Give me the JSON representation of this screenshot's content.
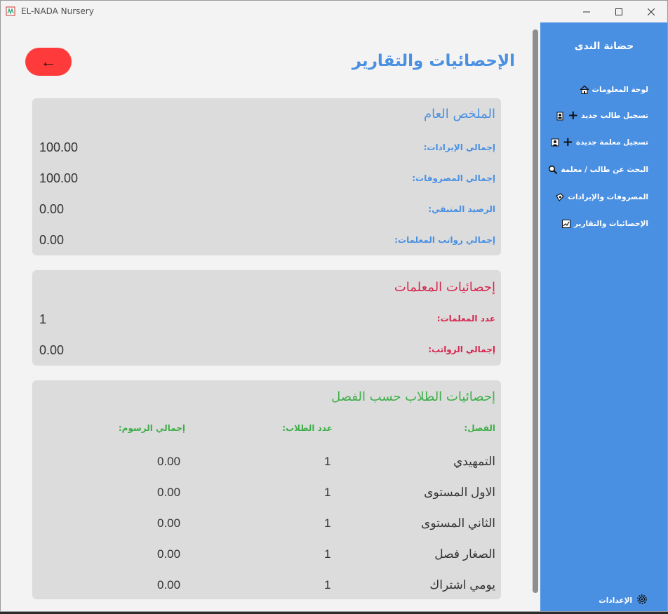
{
  "window": {
    "title": "EL-NADA Nursery"
  },
  "sidebar": {
    "title": "حضانة الندى",
    "items": [
      {
        "label": "لوحة المعلومات",
        "icon": "house-icon"
      },
      {
        "label": "تسجيل طالب جديد",
        "icon": "add-student-icon"
      },
      {
        "label": "تسجيل معلمة جديدة",
        "icon": "add-teacher-icon"
      },
      {
        "label": "البحث عن طالب / معلمة",
        "icon": "search-icon"
      },
      {
        "label": "المصروفات والإيرادات",
        "icon": "money-icon"
      },
      {
        "label": "الإحصائيات والتقارير",
        "icon": "chart-icon"
      }
    ],
    "settings_label": "الإعدادات"
  },
  "main": {
    "back_label": "←",
    "title": "الإحصائيات والتقارير",
    "summary": {
      "title": "الملخص العام",
      "rows": [
        {
          "label": "إجمالي الإيرادات:",
          "value": "100.00"
        },
        {
          "label": "إجمالي المصروفات:",
          "value": "100.00"
        },
        {
          "label": "الرصيد المتبقي:",
          "value": "0.00"
        },
        {
          "label": "إجمالي رواتب المعلمات:",
          "value": "0.00"
        }
      ]
    },
    "teachers": {
      "title": "إحصائيات المعلمات",
      "rows": [
        {
          "label": "عدد المعلمات:",
          "value": "1"
        },
        {
          "label": "إجمالي الرواتب:",
          "value": "0.00"
        }
      ]
    },
    "students": {
      "title": "إحصائيات الطلاب حسب الفصل",
      "columns": [
        "الفصل:",
        "عدد الطلاب:",
        "إجمالي الرسوم:"
      ],
      "rows": [
        {
          "class": "التمهيدي",
          "count": "1",
          "fees": "0.00"
        },
        {
          "class": "الاول المستوى",
          "count": "1",
          "fees": "0.00"
        },
        {
          "class": "الثاني المستوى",
          "count": "1",
          "fees": "0.00"
        },
        {
          "class": "الصغار فصل",
          "count": "1",
          "fees": "0.00"
        },
        {
          "class": "يومي اشتراك",
          "count": "1",
          "fees": "0.00"
        }
      ]
    }
  },
  "colors": {
    "accent": "#4a90e2",
    "back_button": "#ff3a3a",
    "teachers": "#d7264f",
    "students": "#3fae49"
  }
}
